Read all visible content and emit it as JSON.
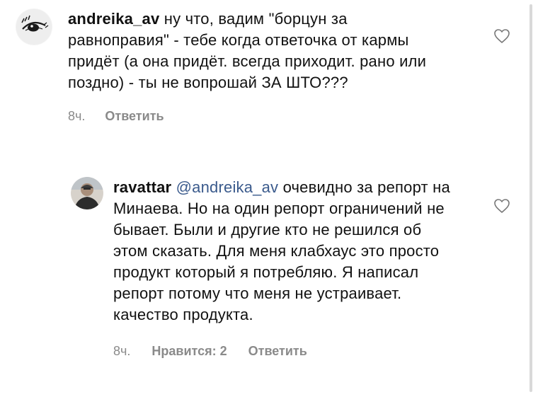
{
  "comments": [
    {
      "username": "andreika_av",
      "text": "ну что, вадим \"борцун за равноправия\" - тебе когда ответочка от кармы придёт (а она придёт. всегда приходит. рано или поздно) - ты не вопрошай ЗА ШТО???",
      "time": "8ч.",
      "reply": "Ответить",
      "avatar_icon": "eye-illustration-icon",
      "like_icon": "heart-icon"
    },
    {
      "username": "ravattar",
      "mention": "@andreika_av",
      "text": "очевидно за репорт на Минаева. Но на один репорт ограничений не бывает. Были и другие кто не решился об этом сказать. Для меня клабхаус это просто продукт который я потребляю. Я написал репорт потому что меня не устраивает. качество продукта.",
      "time": "8ч.",
      "likes": "Нравится: 2",
      "reply": "Ответить",
      "avatar_icon": "profile-photo-avatar",
      "like_icon": "heart-icon"
    }
  ],
  "colors": {
    "meta": "#8a8a8a",
    "mention": "#3a5a8c",
    "text": "#111111"
  }
}
